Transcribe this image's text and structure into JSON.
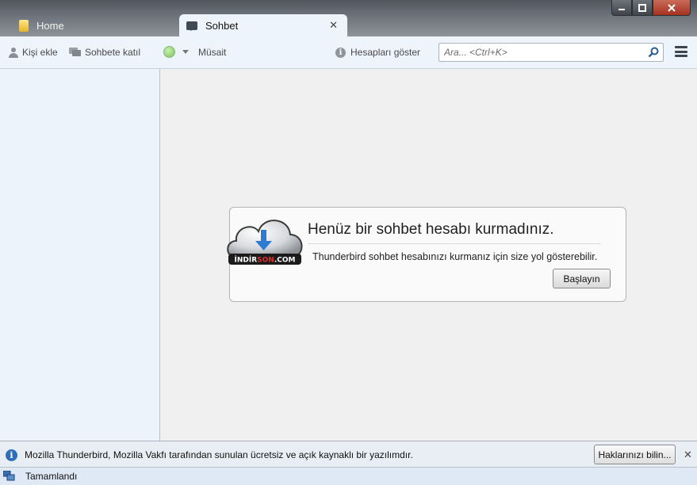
{
  "window": {
    "minimize_label": "▁",
    "maximize_label": "□",
    "close_label": "✕"
  },
  "tabs": [
    {
      "label": "Home",
      "active": false
    },
    {
      "label": "Sohbet",
      "active": true,
      "close_label": "✕"
    }
  ],
  "toolbar": {
    "add_contact": "Kişi ekle",
    "join_chat": "Sohbete katıl",
    "status": "Müsait",
    "status_color": "#7bc35b",
    "show_accounts": "Hesapları göster",
    "search_placeholder": "Ara... <Ctrl+K>",
    "menu_icon": "hamburger-menu-icon"
  },
  "main": {
    "card_title": "Henüz bir sohbet hesabı kurmadınız.",
    "card_description": "Thunderbird sohbet hesabınızı kurmanız için size yol gösterebilir.",
    "start_button": "Başlayın",
    "logo_text": "INDIRSON.COM"
  },
  "notification": {
    "text": "Mozilla Thunderbird, Mozilla Vakfı tarafından sunulan ücretsiz ve açık kaynaklı bir yazılımdır.",
    "rights_button": "Haklarınızı bilin...",
    "close_label": "✕"
  },
  "statusbar": {
    "text": "Tamamlandı"
  }
}
